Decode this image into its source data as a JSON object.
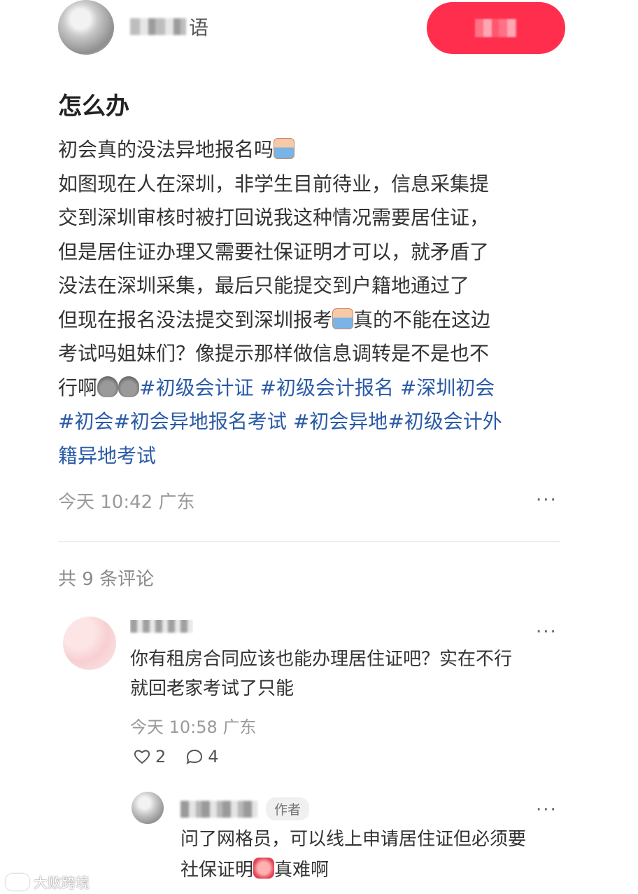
{
  "header": {
    "author_name_visible": "语",
    "follow_label": ""
  },
  "note": {
    "title": "怎么办",
    "lines": [
      "初会真的没法异地报名吗",
      "如图现在人在深圳，非学生目前待业，信息采集提",
      "交到深圳审核时被打回说我这种情况需要居住证，",
      "但是居住证办理又需要社保证明才可以，就矛盾了",
      "没法在深圳采集，最后只能提交到户籍地通过了",
      "但现在报名没法提交到深圳报考",
      "真的不能在这边",
      "考试吗姐妹们？像提示那样做信息调转是不是也不",
      "行啊"
    ],
    "tags": [
      "#初级会计证",
      "#初级会计报名",
      "#深圳初会",
      "#初会",
      "#初会异地报名考试",
      "#初会异地",
      "#初级会计外",
      "籍异地考试"
    ],
    "time": "今天 10:42",
    "location": "广东",
    "more": "···"
  },
  "comments": {
    "count_label": "共 9 条评论",
    "first": {
      "text_line1": "你有租房合同应该也能办理居住证吧？实在不行",
      "text_line2": "就回老家考试了只能",
      "time": "今天 10:58",
      "location": "广东",
      "likes": "2",
      "replies": "4",
      "more": "···"
    },
    "reply": {
      "badge": "作者",
      "text_line1": "问了网格员，可以线上申请居住证但必须要",
      "text_line2a": "社保证明",
      "text_line2b": "真难啊",
      "more": "···"
    }
  },
  "watermark": "大败跨境",
  "colors": {
    "follow_button": "#ff2e4d",
    "tag": "#2a5aa6",
    "meta_gray": "#9a9a9a"
  }
}
